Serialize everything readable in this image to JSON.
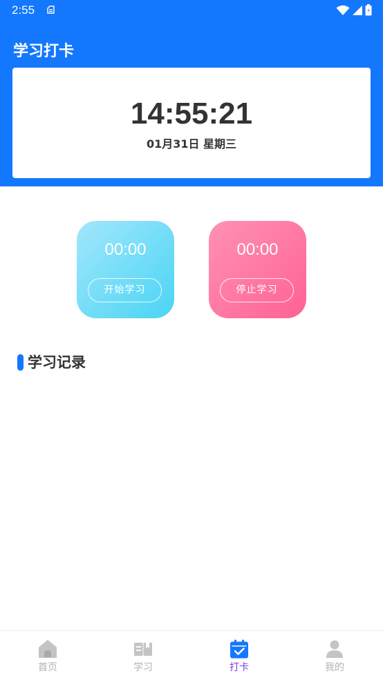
{
  "status_bar": {
    "time": "2:55"
  },
  "header": {
    "title": "学习打卡"
  },
  "clock": {
    "time": "14:55:21",
    "date": "01月31日 星期三"
  },
  "timers": {
    "start": {
      "value": "00:00",
      "button_label": "开始学习"
    },
    "stop": {
      "value": "00:00",
      "button_label": "停止学习"
    }
  },
  "records": {
    "title": "学习记录"
  },
  "tabbar": {
    "items": [
      {
        "label": "首页",
        "icon": "home-icon",
        "active": false
      },
      {
        "label": "学习",
        "icon": "book-icon",
        "active": false
      },
      {
        "label": "打卡",
        "icon": "calendar-check-icon",
        "active": true
      },
      {
        "label": "我的",
        "icon": "person-icon",
        "active": false
      }
    ]
  },
  "colors": {
    "primary": "#1378fe",
    "start_card": "#4ad4f4",
    "stop_card": "#ff6294",
    "active_tab": "#7c3aed",
    "inactive_tab": "#b3b3b3"
  }
}
